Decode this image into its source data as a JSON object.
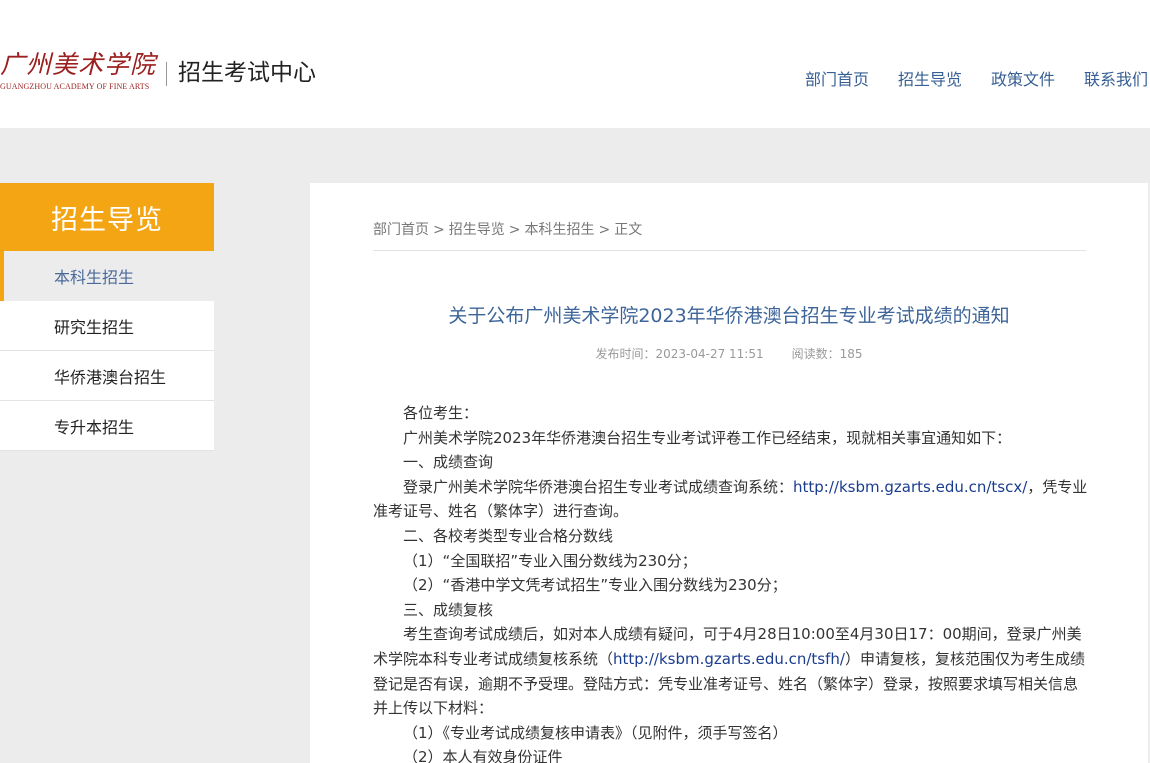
{
  "header": {
    "logo_script": "广州美术学院",
    "logo_en": "GUANGZHOU ACADEMY OF FINE ARTS",
    "site_title": "招生考试中心",
    "nav": [
      "部门首页",
      "招生导览",
      "政策文件",
      "联系我们"
    ]
  },
  "sidebar": {
    "heading": "招生导览",
    "items": [
      {
        "label": "本科生招生"
      },
      {
        "label": "研究生招生"
      },
      {
        "label": "华侨港澳台招生"
      },
      {
        "label": "专升本招生"
      }
    ]
  },
  "breadcrumb": {
    "items": [
      "部门首页",
      "招生导览",
      "本科生招生",
      "正文"
    ],
    "separator": ">"
  },
  "article": {
    "title": "关于公布广州美术学院2023年华侨港澳台招生专业考试成绩的通知",
    "publish_time": "发布时间：2023-04-27 11:51",
    "read_count": "阅读数：185",
    "greeting": "各位考生：",
    "intro": "广州美术学院2023年华侨港澳台招生专业考试评卷工作已经结束，现就相关事宜通知如下：",
    "s1_heading": "一、成绩查询",
    "s1_text_pre": "登录广州美术学院华侨港澳台招生专业考试成绩查询系统：",
    "s1_link": "http://ksbm.gzarts.edu.cn/tscx/",
    "s1_text_post": "，凭专业准考证号、姓名（繁体字）进行查询。",
    "s2_heading": "二、各校考类型专业合格分数线",
    "s2_item1": "（1）“全国联招”专业入围分数线为230分；",
    "s2_item2": "（2）“香港中学文凭考试招生”专业入围分数线为230分；",
    "s3_heading": "三、成绩复核",
    "s3_text_pre": "考生查询考试成绩后，如对本人成绩有疑问，可于4月28日10:00至4月30日17：00期间，登录广州美术学院本科专业考试成绩复核系统（",
    "s3_link": "http://ksbm.gzarts.edu.cn/tsfh/",
    "s3_text_post": "）申请复核，复核范围仅为考生成绩登记是否有误，逾期不予受理。登陆方式：凭专业准考证号、姓名（繁体字）登录，按照要求填写相关信息并上传以下材料：",
    "s3_item1": "（1）《专业考试成绩复核申请表》（见附件，须手写签名）",
    "s3_item2": "（2）本人有效身份证件"
  }
}
